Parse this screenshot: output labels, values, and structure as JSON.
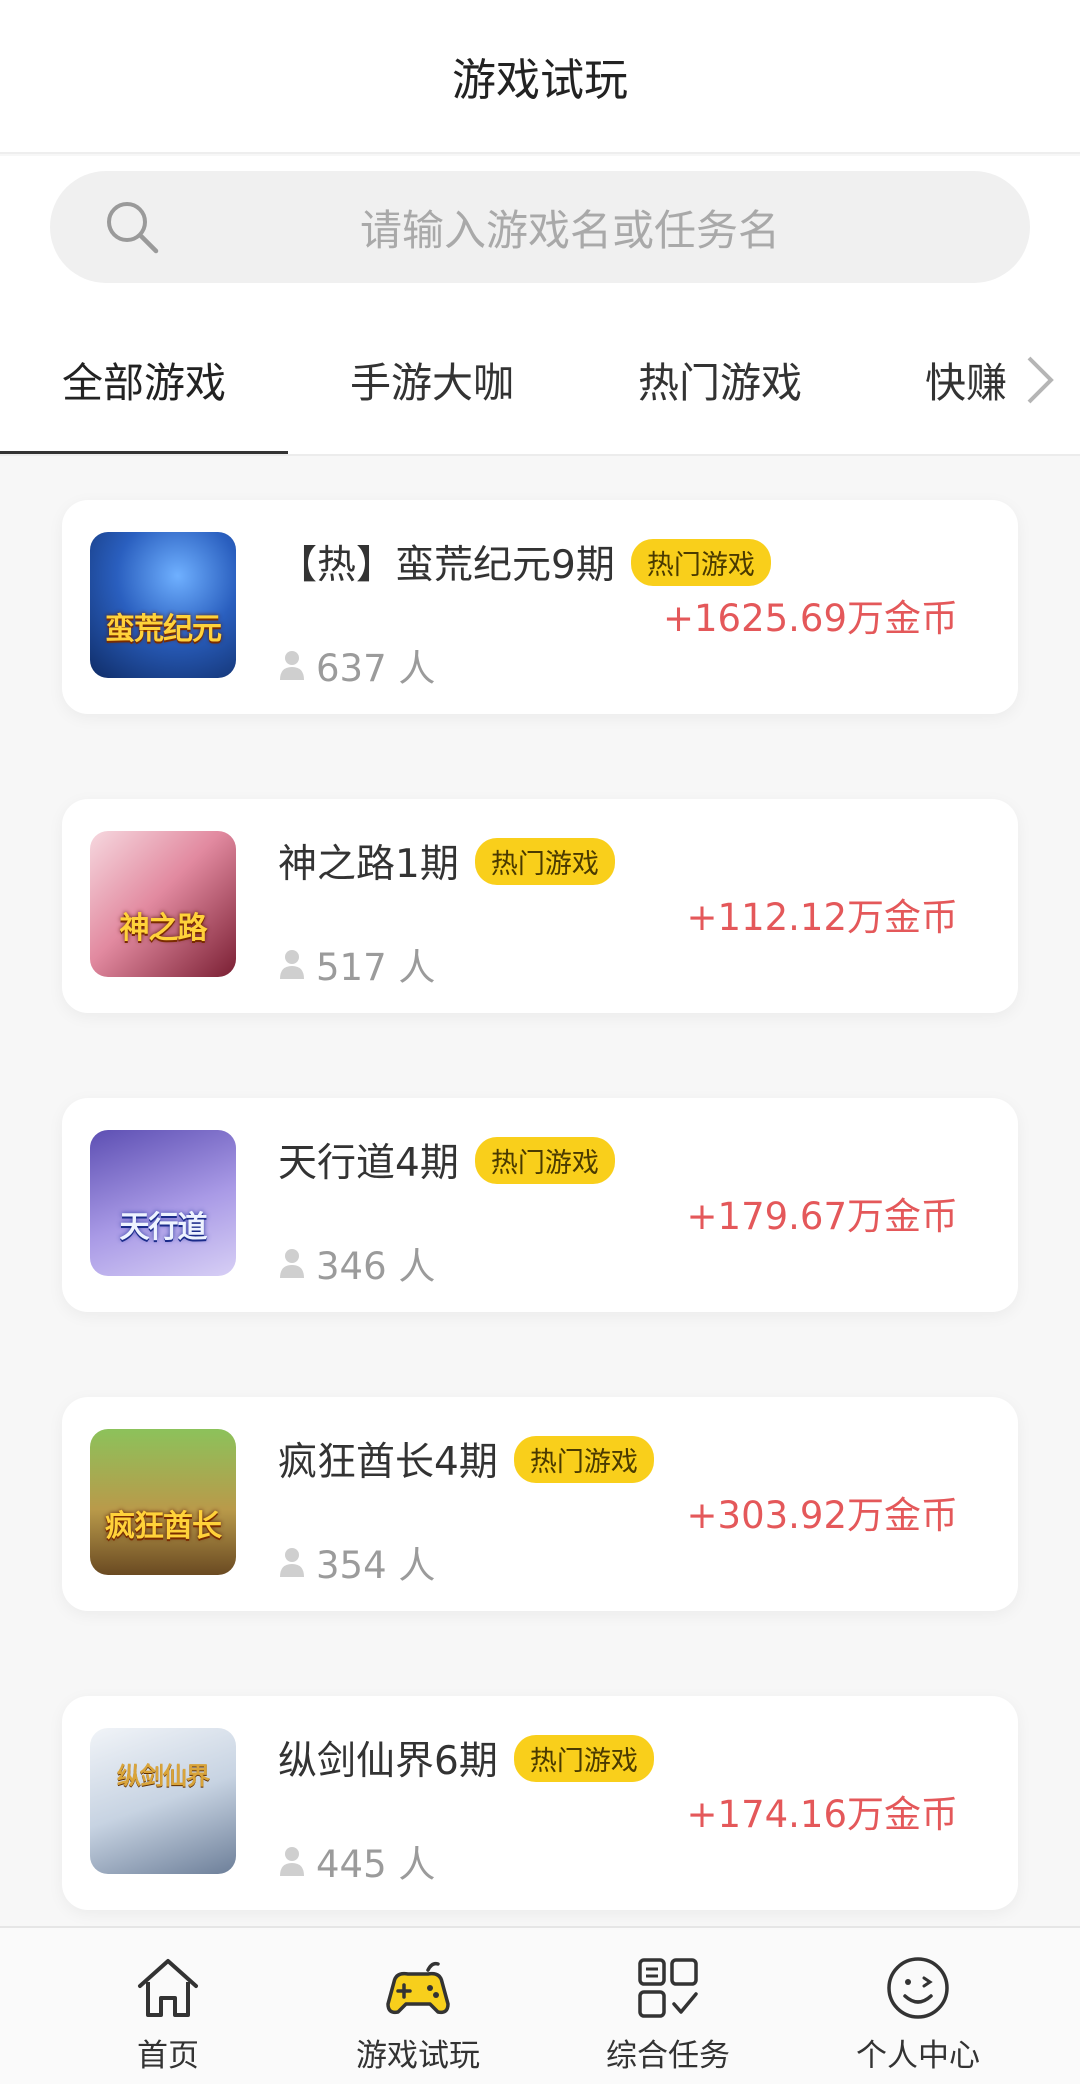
{
  "header": {
    "title": "游戏试玩"
  },
  "search": {
    "placeholder": "请输入游戏名或任务名"
  },
  "tabs": [
    {
      "label": "全部游戏",
      "active": true
    },
    {
      "label": "手游大咖",
      "active": false
    },
    {
      "label": "热门游戏",
      "active": false
    },
    {
      "label": "快赚",
      "active": false
    }
  ],
  "games": [
    {
      "name": "【热】蛮荒纪元9期",
      "badge": "热门游戏",
      "reward": "+1625.69万金币",
      "players": "637 人",
      "thumb_text": "蛮荒纪元",
      "thumb_colors": [
        "#1d3f8a",
        "#3a7bd8"
      ]
    },
    {
      "name": "神之路1期",
      "badge": "热门游戏",
      "reward": "+112.12万金币",
      "players": "517 人",
      "thumb_text": "神之路",
      "thumb_colors": [
        "#e7b8c4",
        "#c13a52"
      ]
    },
    {
      "name": "天行道4期",
      "badge": "热门游戏",
      "reward": "+179.67万金币",
      "players": "346 人",
      "thumb_text": "天行道",
      "thumb_colors": [
        "#8d7fd1",
        "#c6b7ee"
      ]
    },
    {
      "name": "疯狂酋长4期",
      "badge": "热门游戏",
      "reward": "+303.92万金币",
      "players": "354 人",
      "thumb_text": "疯狂酋长",
      "thumb_colors": [
        "#6a9b3c",
        "#d8a24a"
      ]
    },
    {
      "name": "纵剑仙界6期",
      "badge": "热门游戏",
      "reward": "+174.16万金币",
      "players": "445 人",
      "thumb_text": "纵剑仙界",
      "thumb_colors": [
        "#dfe6ee",
        "#8aa3c2"
      ]
    }
  ],
  "bottom_nav": [
    {
      "label": "首页",
      "icon": "home-icon",
      "active": false
    },
    {
      "label": "游戏试玩",
      "icon": "gamepad-icon",
      "active": true
    },
    {
      "label": "综合任务",
      "icon": "task-grid-icon",
      "active": false
    },
    {
      "label": "个人中心",
      "icon": "smiley-icon",
      "active": false
    }
  ],
  "colors": {
    "badge": "#f9cf1b",
    "reward": "#e4585a",
    "accent_nav": "#f7cf1c"
  }
}
